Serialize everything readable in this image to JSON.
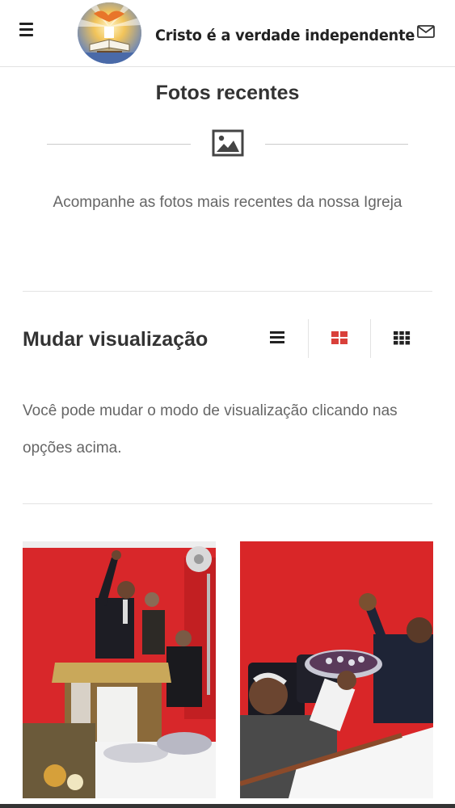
{
  "header": {
    "site_title": "Cristo é a verdade independente",
    "menu_icon": "hamburger-icon",
    "mail_icon": "envelope-icon"
  },
  "recent": {
    "title": "Fotos recentes",
    "icon": "image-icon",
    "subtitle": "Acompanhe as fotos mais recentes da nossa Igreja"
  },
  "view": {
    "title": "Mudar visualização",
    "description": "Você pode mudar o modo de visualização clicando nas opções acima.",
    "options": [
      {
        "icon": "list-icon",
        "active": false
      },
      {
        "icon": "grid-2x2-icon",
        "active": true
      },
      {
        "icon": "grid-3x3-icon",
        "active": false
      }
    ],
    "active_color": "#d9403a"
  },
  "photos": [
    {
      "alt": "photo-preacher-at-pulpit"
    },
    {
      "alt": "photo-men-raising-tray"
    }
  ]
}
